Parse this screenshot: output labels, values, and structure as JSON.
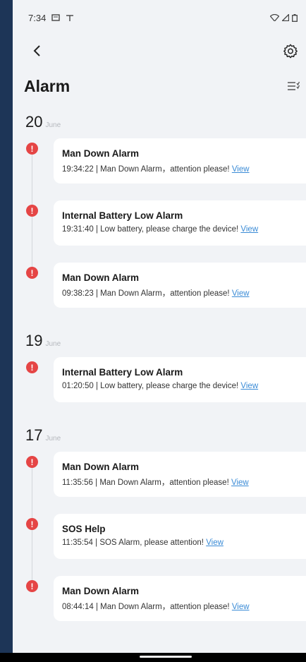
{
  "status_bar": {
    "time": "7:34"
  },
  "header": {
    "title": "Alarm"
  },
  "groups": [
    {
      "day": "20",
      "month": "June",
      "items": [
        {
          "title": "Man Down Alarm",
          "time": "19:34:22",
          "message": "Man Down Alarm，attention please!",
          "link": "View"
        },
        {
          "title": "Internal Battery Low Alarm",
          "time": "19:31:40",
          "message": "Low battery, please charge the device!",
          "link": "View"
        },
        {
          "title": "Man Down Alarm",
          "time": "09:38:23",
          "message": "Man Down Alarm，attention please!",
          "link": "View"
        }
      ]
    },
    {
      "day": "19",
      "month": "June",
      "items": [
        {
          "title": "Internal Battery Low Alarm",
          "time": "01:20:50",
          "message": "Low battery, please charge the device!",
          "link": "View"
        }
      ]
    },
    {
      "day": "17",
      "month": "June",
      "items": [
        {
          "title": "Man Down Alarm",
          "time": "11:35:56",
          "message": "Man Down Alarm，attention please!",
          "link": "View"
        },
        {
          "title": "SOS Help",
          "time": "11:35:54",
          "message": "SOS Alarm, please attention!",
          "link": "View"
        },
        {
          "title": "Man Down Alarm",
          "time": "08:44:14",
          "message": "Man Down Alarm，attention please!",
          "link": "View"
        }
      ]
    }
  ],
  "colors": {
    "alert": "#e54545",
    "link": "#3a8bd6",
    "background": "#f1f3f6",
    "frame": "#1d3557"
  },
  "icons": [
    "back-arrow-icon",
    "gear-icon",
    "filter-list-icon",
    "alert-icon",
    "wifi-icon",
    "signal-icon",
    "battery-icon"
  ]
}
